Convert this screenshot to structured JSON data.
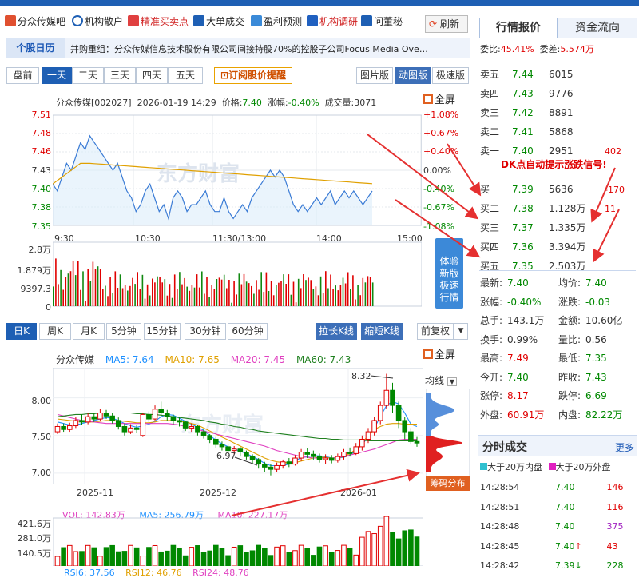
{
  "nav": {
    "items": [
      "分众传媒吧",
      "机构散户",
      "精准买卖点",
      "大单成交",
      "盈利预测",
      "机构调研",
      "问董秘"
    ],
    "refresh": "刷新"
  },
  "news": {
    "label": "个股日历",
    "text": "并购重组：分众传媒信息技术股份有限公司间接持股70%的控股子公司Focus Media Ove…"
  },
  "range_tabs": [
    "盘前",
    "一天",
    "二天",
    "三天",
    "四天",
    "五天"
  ],
  "subscribe": "订阅股价提醒",
  "view_tabs": [
    "图片版",
    "动图版",
    "极速版"
  ],
  "intraday": {
    "name": "分众传媒[002027]",
    "datetime": "2026-01-19 14:29",
    "price_label": "价格:",
    "price": "7.40",
    "chg_label": "涨幅:",
    "chg": "-0.40%",
    "vol_label": "成交量:",
    "vol": "3071",
    "fullscreen": "全屏",
    "y_left": [
      "7.51",
      "7.48",
      "7.46",
      "7.43",
      "7.40",
      "7.38",
      "7.35"
    ],
    "y_right": [
      "+1.08%",
      "+0.67%",
      "+0.40%",
      "0.00%",
      "-0.40%",
      "-0.67%",
      "-1.08%"
    ],
    "x_labels": [
      "9:30",
      "10:30",
      "11:30/13:00",
      "14:00",
      "15:00"
    ],
    "vol_axis": [
      "2.8万",
      "1.879万",
      "9397.3",
      "0"
    ],
    "watermark": "东方财富",
    "experience": "体验新版极速行情",
    "price_series": [
      7.41,
      7.4,
      7.42,
      7.44,
      7.43,
      7.45,
      7.47,
      7.46,
      7.48,
      7.47,
      7.46,
      7.45,
      7.44,
      7.43,
      7.44,
      7.42,
      7.4,
      7.39,
      7.37,
      7.38,
      7.4,
      7.41,
      7.39,
      7.37,
      7.38,
      7.36,
      7.39,
      7.4,
      7.39,
      7.37,
      7.38,
      7.38,
      7.39,
      7.4,
      7.38,
      7.37,
      7.37,
      7.39,
      7.37,
      7.36,
      7.37,
      7.38,
      7.37,
      7.39,
      7.4,
      7.41,
      7.42,
      7.43,
      7.42,
      7.43,
      7.42,
      7.4,
      7.38,
      7.37,
      7.38,
      7.37,
      7.38,
      7.39,
      7.38,
      7.39,
      7.4,
      7.38,
      7.39,
      7.4,
      7.39,
      7.4,
      7.39,
      7.38,
      7.39,
      7.4
    ]
  },
  "kline_tabs": [
    "日K",
    "周K",
    "月K",
    "5分钟",
    "15分钟",
    "30分钟",
    "60分钟"
  ],
  "kline_btns": [
    "拉长K线",
    "缩短K线"
  ],
  "adjust": "前复权",
  "kline": {
    "name": "分众传媒",
    "ma5": "MA5: 7.64",
    "ma10": "MA10: 7.65",
    "ma20": "MA20: 7.45",
    "ma60": "MA60: 7.43",
    "fullscreen": "全屏",
    "y_labels": [
      "8.00",
      "7.50",
      "7.00"
    ],
    "x_labels": [
      "2025-11",
      "2025-12",
      "2026-01"
    ],
    "hi_label": "8.32",
    "lo_label": "6.97",
    "indicator": "均线",
    "chip": "筹码分布",
    "watermark": "东方财富",
    "vol_legend": {
      "vol": "VOL: 142.83万",
      "ma5": "MA5: 256.79万",
      "ma10": "MA10: 227.17万"
    },
    "vol_axis": [
      "421.6万",
      "281.0万",
      "140.5万"
    ],
    "rsi": {
      "r6": "RSI6: 37.56",
      "r12": "RSI12: 46.76",
      "r24": "RSI24: 48.76"
    },
    "candles": [
      {
        "o": 7.55,
        "c": 7.62,
        "h": 7.66,
        "l": 7.52
      },
      {
        "o": 7.62,
        "c": 7.58,
        "h": 7.66,
        "l": 7.55
      },
      {
        "o": 7.58,
        "c": 7.63,
        "h": 7.67,
        "l": 7.55
      },
      {
        "o": 7.63,
        "c": 7.7,
        "h": 7.75,
        "l": 7.6
      },
      {
        "o": 7.7,
        "c": 7.68,
        "h": 7.78,
        "l": 7.64
      },
      {
        "o": 7.68,
        "c": 7.75,
        "h": 7.8,
        "l": 7.65
      },
      {
        "o": 7.75,
        "c": 7.72,
        "h": 7.8,
        "l": 7.68
      },
      {
        "o": 7.72,
        "c": 7.8,
        "h": 7.85,
        "l": 7.7
      },
      {
        "o": 7.8,
        "c": 7.76,
        "h": 7.84,
        "l": 7.72
      },
      {
        "o": 7.76,
        "c": 7.7,
        "h": 7.8,
        "l": 7.66
      },
      {
        "o": 7.7,
        "c": 7.62,
        "h": 7.74,
        "l": 7.58
      },
      {
        "o": 7.62,
        "c": 7.55,
        "h": 7.66,
        "l": 7.5
      },
      {
        "o": 7.55,
        "c": 7.6,
        "h": 7.65,
        "l": 7.52
      },
      {
        "o": 7.6,
        "c": 7.58,
        "h": 7.64,
        "l": 7.54
      },
      {
        "o": 7.5,
        "c": 7.78,
        "h": 7.8,
        "l": 7.48
      },
      {
        "o": 7.78,
        "c": 7.72,
        "h": 7.82,
        "l": 7.68
      },
      {
        "o": 7.72,
        "c": 7.85,
        "h": 7.9,
        "l": 7.7
      },
      {
        "o": 7.85,
        "c": 7.8,
        "h": 7.95,
        "l": 7.76
      },
      {
        "o": 7.8,
        "c": 7.75,
        "h": 7.84,
        "l": 7.7
      },
      {
        "o": 7.75,
        "c": 7.7,
        "h": 7.78,
        "l": 7.65
      },
      {
        "o": 7.7,
        "c": 7.68,
        "h": 7.74,
        "l": 7.62
      },
      {
        "o": 7.68,
        "c": 7.6,
        "h": 7.7,
        "l": 7.56
      },
      {
        "o": 7.6,
        "c": 7.62,
        "h": 7.66,
        "l": 7.55
      },
      {
        "o": 7.62,
        "c": 7.55,
        "h": 7.64,
        "l": 7.5
      },
      {
        "o": 7.55,
        "c": 7.5,
        "h": 7.58,
        "l": 7.46
      },
      {
        "o": 7.5,
        "c": 7.45,
        "h": 7.52,
        "l": 7.4
      },
      {
        "o": 7.45,
        "c": 7.38,
        "h": 7.48,
        "l": 7.34
      },
      {
        "o": 7.38,
        "c": 7.35,
        "h": 7.42,
        "l": 7.3
      },
      {
        "o": 7.35,
        "c": 7.3,
        "h": 7.38,
        "l": 7.26
      },
      {
        "o": 7.3,
        "c": 7.32,
        "h": 7.36,
        "l": 7.25
      },
      {
        "o": 7.32,
        "c": 7.28,
        "h": 7.35,
        "l": 7.22
      },
      {
        "o": 7.28,
        "c": 7.22,
        "h": 7.3,
        "l": 7.18
      },
      {
        "o": 7.22,
        "c": 7.18,
        "h": 7.25,
        "l": 7.12
      },
      {
        "o": 7.18,
        "c": 7.12,
        "h": 7.2,
        "l": 7.06
      },
      {
        "o": 7.12,
        "c": 7.08,
        "h": 7.15,
        "l": 7.02
      },
      {
        "o": 7.08,
        "c": 7.05,
        "h": 7.12,
        "l": 6.97
      },
      {
        "o": 7.05,
        "c": 7.1,
        "h": 7.14,
        "l": 7.02
      },
      {
        "o": 7.1,
        "c": 7.15,
        "h": 7.18,
        "l": 7.06
      },
      {
        "o": 7.15,
        "c": 7.12,
        "h": 7.2,
        "l": 7.08
      },
      {
        "o": 7.12,
        "c": 7.2,
        "h": 7.24,
        "l": 7.1
      },
      {
        "o": 7.2,
        "c": 7.28,
        "h": 7.32,
        "l": 7.16
      },
      {
        "o": 7.28,
        "c": 7.25,
        "h": 7.33,
        "l": 7.2
      },
      {
        "o": 7.25,
        "c": 7.22,
        "h": 7.3,
        "l": 7.18
      },
      {
        "o": 7.22,
        "c": 7.18,
        "h": 7.26,
        "l": 7.14
      },
      {
        "o": 7.18,
        "c": 7.2,
        "h": 7.25,
        "l": 7.12
      },
      {
        "o": 7.2,
        "c": 7.17,
        "h": 7.24,
        "l": 7.13
      },
      {
        "o": 7.17,
        "c": 7.22,
        "h": 7.26,
        "l": 7.14
      },
      {
        "o": 7.22,
        "c": 7.28,
        "h": 7.32,
        "l": 7.18
      },
      {
        "o": 7.28,
        "c": 7.26,
        "h": 7.34,
        "l": 7.22
      },
      {
        "o": 7.26,
        "c": 7.35,
        "h": 7.4,
        "l": 7.24
      },
      {
        "o": 7.35,
        "c": 7.45,
        "h": 7.5,
        "l": 7.3
      },
      {
        "o": 7.45,
        "c": 7.55,
        "h": 7.6,
        "l": 7.4
      },
      {
        "o": 7.55,
        "c": 7.7,
        "h": 7.75,
        "l": 7.5
      },
      {
        "o": 7.7,
        "c": 7.9,
        "h": 7.95,
        "l": 7.65
      },
      {
        "o": 7.9,
        "c": 8.1,
        "h": 8.32,
        "l": 7.85
      },
      {
        "o": 8.1,
        "c": 7.9,
        "h": 8.2,
        "l": 7.8
      },
      {
        "o": 7.9,
        "c": 7.7,
        "h": 7.95,
        "l": 7.6
      },
      {
        "o": 7.7,
        "c": 7.55,
        "h": 7.75,
        "l": 7.45
      },
      {
        "o": 7.55,
        "c": 7.42,
        "h": 7.6,
        "l": 7.38
      },
      {
        "o": 7.42,
        "c": 7.4,
        "h": 7.48,
        "l": 7.35
      }
    ],
    "ma_series": [
      [
        7.68,
        7.66,
        7.64,
        7.64,
        7.66,
        7.68,
        7.7,
        7.72,
        7.74,
        7.73,
        7.7,
        7.66,
        7.63,
        7.61,
        7.63,
        7.65,
        7.69,
        7.75,
        7.78,
        7.77,
        7.73,
        7.69,
        7.65,
        7.61,
        7.57,
        7.5,
        7.44,
        7.39,
        7.35,
        7.32,
        7.29,
        7.26,
        7.22,
        7.18,
        7.13,
        7.1,
        7.1,
        7.1,
        7.12,
        7.17,
        7.2,
        7.22,
        7.23,
        7.23,
        7.22,
        7.2,
        7.2,
        7.21,
        7.24,
        7.3,
        7.38,
        7.48,
        7.6,
        7.75,
        7.9,
        7.95,
        7.92,
        7.8,
        7.65,
        7.62
      ],
      [
        7.72,
        7.71,
        7.7,
        7.69,
        7.69,
        7.68,
        7.68,
        7.69,
        7.7,
        7.7,
        7.7,
        7.69,
        7.68,
        7.67,
        7.67,
        7.67,
        7.68,
        7.7,
        7.7,
        7.7,
        7.69,
        7.68,
        7.66,
        7.64,
        7.6,
        7.56,
        7.52,
        7.48,
        7.44,
        7.4,
        7.36,
        7.32,
        7.28,
        7.24,
        7.2,
        7.17,
        7.15,
        7.14,
        7.14,
        7.14,
        7.16,
        7.18,
        7.2,
        7.21,
        7.21,
        7.2,
        7.2,
        7.22,
        7.26,
        7.32,
        7.4,
        7.5,
        7.58,
        7.62,
        7.65,
        7.66,
        7.66,
        7.65,
        7.65,
        7.65
      ],
      [
        7.78,
        7.76,
        7.74,
        7.72,
        7.7,
        7.69,
        7.68,
        7.67,
        7.66,
        7.66,
        7.66,
        7.66,
        7.66,
        7.66,
        7.66,
        7.66,
        7.66,
        7.66,
        7.66,
        7.65,
        7.64,
        7.62,
        7.6,
        7.58,
        7.56,
        7.54,
        7.52,
        7.5,
        7.48,
        7.46,
        7.44,
        7.42,
        7.4,
        7.38,
        7.36,
        7.33,
        7.3,
        7.28,
        7.26,
        7.24,
        7.22,
        7.21,
        7.2,
        7.2,
        7.2,
        7.2,
        7.21,
        7.22,
        7.24,
        7.26,
        7.28,
        7.3,
        7.32,
        7.35,
        7.38,
        7.41,
        7.44,
        7.45,
        7.45,
        7.45
      ],
      [
        7.75,
        7.76,
        7.77,
        7.78,
        7.78,
        7.79,
        7.79,
        7.8,
        7.8,
        7.8,
        7.8,
        7.8,
        7.8,
        7.79,
        7.79,
        7.78,
        7.78,
        7.77,
        7.76,
        7.75,
        7.74,
        7.73,
        7.72,
        7.71,
        7.7,
        7.68,
        7.67,
        7.65,
        7.64,
        7.62,
        7.61,
        7.59,
        7.58,
        7.56,
        7.55,
        7.54,
        7.53,
        7.52,
        7.51,
        7.5,
        7.49,
        7.48,
        7.47,
        7.46,
        7.46,
        7.45,
        7.45,
        7.44,
        7.44,
        7.44,
        7.44,
        7.43,
        7.43,
        7.43,
        7.43,
        7.43,
        7.43,
        7.43,
        7.43,
        7.43
      ]
    ]
  },
  "right": {
    "tabs": [
      "行情报价",
      "资金流向"
    ],
    "weibi_label": "委比:",
    "weibi": "45.41%",
    "weicha_label": "委差:",
    "weicha": "5.574万",
    "sells": [
      {
        "label": "卖五",
        "price": "7.44",
        "vol": "6015",
        "chg": ""
      },
      {
        "label": "卖四",
        "price": "7.43",
        "vol": "9776",
        "chg": ""
      },
      {
        "label": "卖三",
        "price": "7.42",
        "vol": "8891",
        "chg": ""
      },
      {
        "label": "卖二",
        "price": "7.41",
        "vol": "5868",
        "chg": ""
      },
      {
        "label": "卖一",
        "price": "7.40",
        "vol": "2951",
        "chg": "402"
      }
    ],
    "dk_note": "DK点自动提示涨跌信号!",
    "buys": [
      {
        "label": "买一",
        "price": "7.39",
        "vol": "5636",
        "chg": "-170"
      },
      {
        "label": "买二",
        "price": "7.38",
        "vol": "1.128万",
        "chg": "11"
      },
      {
        "label": "买三",
        "price": "7.37",
        "vol": "1.335万",
        "chg": ""
      },
      {
        "label": "买四",
        "price": "7.36",
        "vol": "3.394万",
        "chg": ""
      },
      {
        "label": "买五",
        "price": "7.35",
        "vol": "2.503万",
        "chg": ""
      }
    ],
    "stats": [
      [
        "最新:",
        "7.40",
        "均价:",
        "7.40"
      ],
      [
        "涨幅:",
        "-0.40%",
        "涨跌:",
        "-0.03"
      ],
      [
        "总手:",
        "143.1万",
        "金额:",
        "10.60亿"
      ],
      [
        "换手:",
        "0.99%",
        "量比:",
        "0.56"
      ],
      [
        "最高:",
        "7.49",
        "最低:",
        "7.35"
      ],
      [
        "今开:",
        "7.40",
        "昨收:",
        "7.43"
      ],
      [
        "涨停:",
        "8.17",
        "跌停:",
        "6.69"
      ],
      [
        "外盘:",
        "60.91万",
        "内盘:",
        "82.22万"
      ]
    ],
    "ticks_title": "分时成交",
    "more": "更多",
    "legend_in": "大于20万内盘",
    "legend_out": "大于20万外盘",
    "ticks": [
      {
        "t": "14:28:54",
        "p": "7.40",
        "v": "146",
        "dir": "",
        "c": "red"
      },
      {
        "t": "14:28:51",
        "p": "7.40",
        "v": "116",
        "dir": "",
        "c": "red"
      },
      {
        "t": "14:28:48",
        "p": "7.40",
        "v": "375",
        "dir": "",
        "c": "purple"
      },
      {
        "t": "14:28:45",
        "p": "7.40",
        "v": "43",
        "dir": "↑",
        "c": "red"
      },
      {
        "t": "14:28:42",
        "p": "7.39",
        "v": "228",
        "dir": "↓",
        "c": "green"
      }
    ]
  },
  "colors": {
    "accent": "#1e5fb4",
    "up": "#e00000",
    "down": "#008800",
    "ma5": "#1e90ff",
    "ma10": "#e0a000",
    "ma20": "#e040c0",
    "ma60": "#208020"
  }
}
